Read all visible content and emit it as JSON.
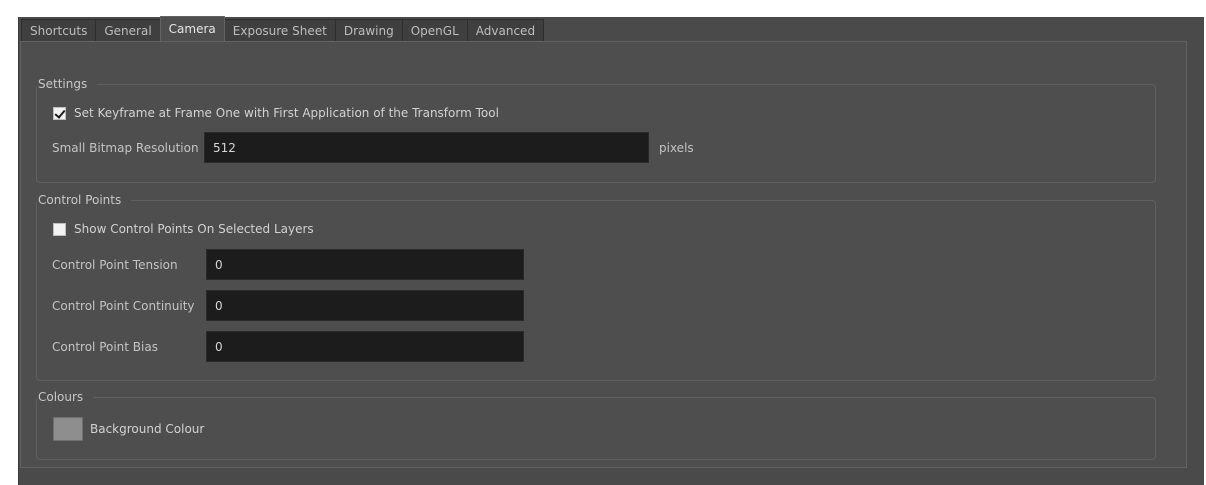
{
  "tabs": [
    {
      "label": "Shortcuts",
      "active": false
    },
    {
      "label": "General",
      "active": false
    },
    {
      "label": "Camera",
      "active": true
    },
    {
      "label": "Exposure Sheet",
      "active": false
    },
    {
      "label": "Drawing",
      "active": false
    },
    {
      "label": "OpenGL",
      "active": false
    },
    {
      "label": "Advanced",
      "active": false
    }
  ],
  "settings": {
    "title": "Settings",
    "set_keyframe": {
      "label": "Set Keyframe at Frame One with First Application of the Transform Tool",
      "checked": true
    },
    "bitmap_resolution": {
      "label": "Small Bitmap Resolution",
      "value": "512",
      "unit": "pixels"
    }
  },
  "control_points": {
    "title": "Control Points",
    "show_points": {
      "label": "Show Control Points On Selected Layers",
      "checked": false
    },
    "tension": {
      "label": "Control Point Tension",
      "value": "0"
    },
    "continuity": {
      "label": "Control Point Continuity",
      "value": "0"
    },
    "bias": {
      "label": "Control Point Bias",
      "value": "0"
    }
  },
  "colours": {
    "title": "Colours",
    "background": {
      "label": "Background Colour",
      "color": "#8e8e8e"
    }
  }
}
